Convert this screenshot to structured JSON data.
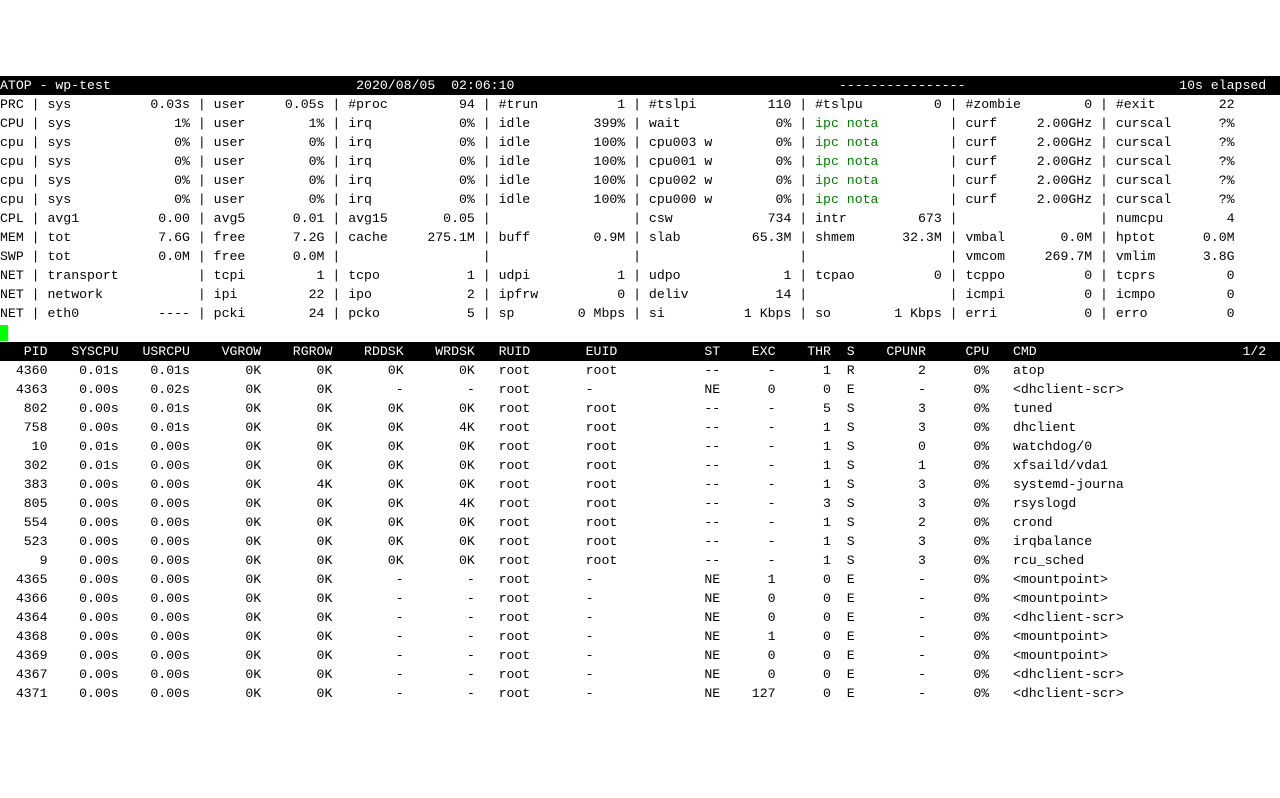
{
  "header": {
    "app": "ATOP",
    "host": "wp-test",
    "date": "2020/08/05",
    "time": "02:06:10",
    "dashes": "----------------",
    "elapsed": "10s elapsed"
  },
  "sys": [
    {
      "label": "PRC",
      "c1": {
        "k": "sys",
        "v": "0.03s"
      },
      "c2": {
        "k": "user",
        "v": "0.05s"
      },
      "c3": {
        "k": "#proc",
        "v": "94"
      },
      "c4": {
        "k": "#trun",
        "v": "1"
      },
      "c5": {
        "k": "#tslpi",
        "v": "110"
      },
      "c6": {
        "k": "#tslpu",
        "v": "0"
      },
      "c7": {
        "k": "#zombie",
        "v": "0"
      },
      "c8": {
        "k": "#exit",
        "v": "22"
      }
    },
    {
      "label": "CPU",
      "c1": {
        "k": "sys",
        "v": "1%"
      },
      "c2": {
        "k": "user",
        "v": "1%"
      },
      "c3": {
        "k": "irq",
        "v": "0%"
      },
      "c4": {
        "k": "idle",
        "v": "399%"
      },
      "c5": {
        "k": "wait",
        "v": "0%"
      },
      "c6": {
        "k": "ipc notavail",
        "v": "",
        "green": true
      },
      "c7": {
        "k": "curf",
        "v": "2.00GHz"
      },
      "c8": {
        "k": "curscal",
        "v": "?%"
      }
    },
    {
      "label": "cpu",
      "c1": {
        "k": "sys",
        "v": "0%"
      },
      "c2": {
        "k": "user",
        "v": "0%"
      },
      "c3": {
        "k": "irq",
        "v": "0%"
      },
      "c4": {
        "k": "idle",
        "v": "100%"
      },
      "c5": {
        "k": "cpu003 w",
        "v": "0%"
      },
      "c6": {
        "k": "ipc notavail",
        "v": "",
        "green": true
      },
      "c7": {
        "k": "curf",
        "v": "2.00GHz"
      },
      "c8": {
        "k": "curscal",
        "v": "?%"
      }
    },
    {
      "label": "cpu",
      "c1": {
        "k": "sys",
        "v": "0%"
      },
      "c2": {
        "k": "user",
        "v": "0%"
      },
      "c3": {
        "k": "irq",
        "v": "0%"
      },
      "c4": {
        "k": "idle",
        "v": "100%"
      },
      "c5": {
        "k": "cpu001 w",
        "v": "0%"
      },
      "c6": {
        "k": "ipc notavail",
        "v": "",
        "green": true
      },
      "c7": {
        "k": "curf",
        "v": "2.00GHz"
      },
      "c8": {
        "k": "curscal",
        "v": "?%"
      }
    },
    {
      "label": "cpu",
      "c1": {
        "k": "sys",
        "v": "0%"
      },
      "c2": {
        "k": "user",
        "v": "0%"
      },
      "c3": {
        "k": "irq",
        "v": "0%"
      },
      "c4": {
        "k": "idle",
        "v": "100%"
      },
      "c5": {
        "k": "cpu002 w",
        "v": "0%"
      },
      "c6": {
        "k": "ipc notavail",
        "v": "",
        "green": true
      },
      "c7": {
        "k": "curf",
        "v": "2.00GHz"
      },
      "c8": {
        "k": "curscal",
        "v": "?%"
      }
    },
    {
      "label": "cpu",
      "c1": {
        "k": "sys",
        "v": "0%"
      },
      "c2": {
        "k": "user",
        "v": "0%"
      },
      "c3": {
        "k": "irq",
        "v": "0%"
      },
      "c4": {
        "k": "idle",
        "v": "100%"
      },
      "c5": {
        "k": "cpu000 w",
        "v": "0%"
      },
      "c6": {
        "k": "ipc notavail",
        "v": "",
        "green": true
      },
      "c7": {
        "k": "curf",
        "v": "2.00GHz"
      },
      "c8": {
        "k": "curscal",
        "v": "?%"
      }
    },
    {
      "label": "CPL",
      "c1": {
        "k": "avg1",
        "v": "0.00"
      },
      "c2": {
        "k": "avg5",
        "v": "0.01"
      },
      "c3": {
        "k": "avg15",
        "v": "0.05"
      },
      "c4": {
        "k": "",
        "v": ""
      },
      "c5": {
        "k": "csw",
        "v": "734"
      },
      "c6": {
        "k": "intr",
        "v": "673"
      },
      "c7": {
        "k": "",
        "v": ""
      },
      "c8": {
        "k": "numcpu",
        "v": "4"
      }
    },
    {
      "label": "MEM",
      "c1": {
        "k": "tot",
        "v": "7.6G"
      },
      "c2": {
        "k": "free",
        "v": "7.2G"
      },
      "c3": {
        "k": "cache",
        "v": "275.1M"
      },
      "c4": {
        "k": "buff",
        "v": "0.9M"
      },
      "c5": {
        "k": "slab",
        "v": "65.3M"
      },
      "c6": {
        "k": "shmem",
        "v": "32.3M"
      },
      "c7": {
        "k": "vmbal",
        "v": "0.0M"
      },
      "c8": {
        "k": "hptot",
        "v": "0.0M"
      }
    },
    {
      "label": "SWP",
      "c1": {
        "k": "tot",
        "v": "0.0M"
      },
      "c2": {
        "k": "free",
        "v": "0.0M"
      },
      "c3": {
        "k": "",
        "v": ""
      },
      "c4": {
        "k": "",
        "v": ""
      },
      "c5": {
        "k": "",
        "v": ""
      },
      "c6": {
        "k": "",
        "v": ""
      },
      "c7": {
        "k": "vmcom",
        "v": "269.7M"
      },
      "c8": {
        "k": "vmlim",
        "v": "3.8G"
      }
    },
    {
      "label": "NET",
      "c1": {
        "k": "transport",
        "v": ""
      },
      "c2": {
        "k": "tcpi",
        "v": "1"
      },
      "c3": {
        "k": "tcpo",
        "v": "1"
      },
      "c4": {
        "k": "udpi",
        "v": "1"
      },
      "c5": {
        "k": "udpo",
        "v": "1"
      },
      "c6": {
        "k": "tcpao",
        "v": "0"
      },
      "c7": {
        "k": "tcppo",
        "v": "0"
      },
      "c8": {
        "k": "tcprs",
        "v": "0"
      }
    },
    {
      "label": "NET",
      "c1": {
        "k": "network",
        "v": ""
      },
      "c2": {
        "k": "ipi",
        "v": "22"
      },
      "c3": {
        "k": "ipo",
        "v": "2"
      },
      "c4": {
        "k": "ipfrw",
        "v": "0"
      },
      "c5": {
        "k": "deliv",
        "v": "14"
      },
      "c6": {
        "k": "",
        "v": ""
      },
      "c7": {
        "k": "icmpi",
        "v": "0"
      },
      "c8": {
        "k": "icmpo",
        "v": "0"
      }
    },
    {
      "label": "NET",
      "c1": {
        "k": "eth0",
        "v": "----"
      },
      "c2": {
        "k": "pcki",
        "v": "24"
      },
      "c3": {
        "k": "pcko",
        "v": "5"
      },
      "c4": {
        "k": "sp",
        "v": "0 Mbps"
      },
      "c5": {
        "k": "si",
        "v": "1 Kbps"
      },
      "c6": {
        "k": "so",
        "v": "1 Kbps"
      },
      "c7": {
        "k": "erri",
        "v": "0"
      },
      "c8": {
        "k": "erro",
        "v": "0"
      }
    }
  ],
  "proc_hdr": {
    "pid": "PID",
    "syscpu": "SYSCPU",
    "usrcpu": "USRCPU",
    "vgrow": "VGROW",
    "rgrow": "RGROW",
    "rddsk": "RDDSK",
    "wrdsk": "WRDSK",
    "ruid": "RUID",
    "euid": "EUID",
    "st": "ST",
    "exc": "EXC",
    "thr": "THR",
    "s": "S",
    "cpunr": "CPUNR",
    "cpu": "CPU",
    "cmd": "CMD",
    "page": "1/2"
  },
  "procs": [
    {
      "pid": "4360",
      "syscpu": "0.01s",
      "usrcpu": "0.01s",
      "vgrow": "0K",
      "rgrow": "0K",
      "rddsk": "0K",
      "wrdsk": "0K",
      "ruid": "root",
      "euid": "root",
      "st": "--",
      "exc": "-",
      "thr": "1",
      "s": "R",
      "cpunr": "2",
      "cpu": "0%",
      "cmd": "atop"
    },
    {
      "pid": "4363",
      "syscpu": "0.00s",
      "usrcpu": "0.02s",
      "vgrow": "0K",
      "rgrow": "0K",
      "rddsk": "-",
      "wrdsk": "-",
      "ruid": "root",
      "euid": "-",
      "st": "NE",
      "exc": "0",
      "thr": "0",
      "s": "E",
      "cpunr": "-",
      "cpu": "0%",
      "cmd": "<dhclient-scr>"
    },
    {
      "pid": "802",
      "syscpu": "0.00s",
      "usrcpu": "0.01s",
      "vgrow": "0K",
      "rgrow": "0K",
      "rddsk": "0K",
      "wrdsk": "0K",
      "ruid": "root",
      "euid": "root",
      "st": "--",
      "exc": "-",
      "thr": "5",
      "s": "S",
      "cpunr": "3",
      "cpu": "0%",
      "cmd": "tuned"
    },
    {
      "pid": "758",
      "syscpu": "0.00s",
      "usrcpu": "0.01s",
      "vgrow": "0K",
      "rgrow": "0K",
      "rddsk": "0K",
      "wrdsk": "4K",
      "ruid": "root",
      "euid": "root",
      "st": "--",
      "exc": "-",
      "thr": "1",
      "s": "S",
      "cpunr": "3",
      "cpu": "0%",
      "cmd": "dhclient"
    },
    {
      "pid": "10",
      "syscpu": "0.01s",
      "usrcpu": "0.00s",
      "vgrow": "0K",
      "rgrow": "0K",
      "rddsk": "0K",
      "wrdsk": "0K",
      "ruid": "root",
      "euid": "root",
      "st": "--",
      "exc": "-",
      "thr": "1",
      "s": "S",
      "cpunr": "0",
      "cpu": "0%",
      "cmd": "watchdog/0"
    },
    {
      "pid": "302",
      "syscpu": "0.01s",
      "usrcpu": "0.00s",
      "vgrow": "0K",
      "rgrow": "0K",
      "rddsk": "0K",
      "wrdsk": "0K",
      "ruid": "root",
      "euid": "root",
      "st": "--",
      "exc": "-",
      "thr": "1",
      "s": "S",
      "cpunr": "1",
      "cpu": "0%",
      "cmd": "xfsaild/vda1"
    },
    {
      "pid": "383",
      "syscpu": "0.00s",
      "usrcpu": "0.00s",
      "vgrow": "0K",
      "rgrow": "4K",
      "rddsk": "0K",
      "wrdsk": "0K",
      "ruid": "root",
      "euid": "root",
      "st": "--",
      "exc": "-",
      "thr": "1",
      "s": "S",
      "cpunr": "3",
      "cpu": "0%",
      "cmd": "systemd-journa"
    },
    {
      "pid": "805",
      "syscpu": "0.00s",
      "usrcpu": "0.00s",
      "vgrow": "0K",
      "rgrow": "0K",
      "rddsk": "0K",
      "wrdsk": "4K",
      "ruid": "root",
      "euid": "root",
      "st": "--",
      "exc": "-",
      "thr": "3",
      "s": "S",
      "cpunr": "3",
      "cpu": "0%",
      "cmd": "rsyslogd"
    },
    {
      "pid": "554",
      "syscpu": "0.00s",
      "usrcpu": "0.00s",
      "vgrow": "0K",
      "rgrow": "0K",
      "rddsk": "0K",
      "wrdsk": "0K",
      "ruid": "root",
      "euid": "root",
      "st": "--",
      "exc": "-",
      "thr": "1",
      "s": "S",
      "cpunr": "2",
      "cpu": "0%",
      "cmd": "crond"
    },
    {
      "pid": "523",
      "syscpu": "0.00s",
      "usrcpu": "0.00s",
      "vgrow": "0K",
      "rgrow": "0K",
      "rddsk": "0K",
      "wrdsk": "0K",
      "ruid": "root",
      "euid": "root",
      "st": "--",
      "exc": "-",
      "thr": "1",
      "s": "S",
      "cpunr": "3",
      "cpu": "0%",
      "cmd": "irqbalance"
    },
    {
      "pid": "9",
      "syscpu": "0.00s",
      "usrcpu": "0.00s",
      "vgrow": "0K",
      "rgrow": "0K",
      "rddsk": "0K",
      "wrdsk": "0K",
      "ruid": "root",
      "euid": "root",
      "st": "--",
      "exc": "-",
      "thr": "1",
      "s": "S",
      "cpunr": "3",
      "cpu": "0%",
      "cmd": "rcu_sched"
    },
    {
      "pid": "4365",
      "syscpu": "0.00s",
      "usrcpu": "0.00s",
      "vgrow": "0K",
      "rgrow": "0K",
      "rddsk": "-",
      "wrdsk": "-",
      "ruid": "root",
      "euid": "-",
      "st": "NE",
      "exc": "1",
      "thr": "0",
      "s": "E",
      "cpunr": "-",
      "cpu": "0%",
      "cmd": "<mountpoint>"
    },
    {
      "pid": "4366",
      "syscpu": "0.00s",
      "usrcpu": "0.00s",
      "vgrow": "0K",
      "rgrow": "0K",
      "rddsk": "-",
      "wrdsk": "-",
      "ruid": "root",
      "euid": "-",
      "st": "NE",
      "exc": "0",
      "thr": "0",
      "s": "E",
      "cpunr": "-",
      "cpu": "0%",
      "cmd": "<mountpoint>"
    },
    {
      "pid": "4364",
      "syscpu": "0.00s",
      "usrcpu": "0.00s",
      "vgrow": "0K",
      "rgrow": "0K",
      "rddsk": "-",
      "wrdsk": "-",
      "ruid": "root",
      "euid": "-",
      "st": "NE",
      "exc": "0",
      "thr": "0",
      "s": "E",
      "cpunr": "-",
      "cpu": "0%",
      "cmd": "<dhclient-scr>"
    },
    {
      "pid": "4368",
      "syscpu": "0.00s",
      "usrcpu": "0.00s",
      "vgrow": "0K",
      "rgrow": "0K",
      "rddsk": "-",
      "wrdsk": "-",
      "ruid": "root",
      "euid": "-",
      "st": "NE",
      "exc": "1",
      "thr": "0",
      "s": "E",
      "cpunr": "-",
      "cpu": "0%",
      "cmd": "<mountpoint>"
    },
    {
      "pid": "4369",
      "syscpu": "0.00s",
      "usrcpu": "0.00s",
      "vgrow": "0K",
      "rgrow": "0K",
      "rddsk": "-",
      "wrdsk": "-",
      "ruid": "root",
      "euid": "-",
      "st": "NE",
      "exc": "0",
      "thr": "0",
      "s": "E",
      "cpunr": "-",
      "cpu": "0%",
      "cmd": "<mountpoint>"
    },
    {
      "pid": "4367",
      "syscpu": "0.00s",
      "usrcpu": "0.00s",
      "vgrow": "0K",
      "rgrow": "0K",
      "rddsk": "-",
      "wrdsk": "-",
      "ruid": "root",
      "euid": "-",
      "st": "NE",
      "exc": "0",
      "thr": "0",
      "s": "E",
      "cpunr": "-",
      "cpu": "0%",
      "cmd": "<dhclient-scr>"
    },
    {
      "pid": "4371",
      "syscpu": "0.00s",
      "usrcpu": "0.00s",
      "vgrow": "0K",
      "rgrow": "0K",
      "rddsk": "-",
      "wrdsk": "-",
      "ruid": "root",
      "euid": "-",
      "st": "NE",
      "exc": "127",
      "thr": "0",
      "s": "E",
      "cpunr": "-",
      "cpu": "0%",
      "cmd": "<dhclient-scr>"
    }
  ]
}
